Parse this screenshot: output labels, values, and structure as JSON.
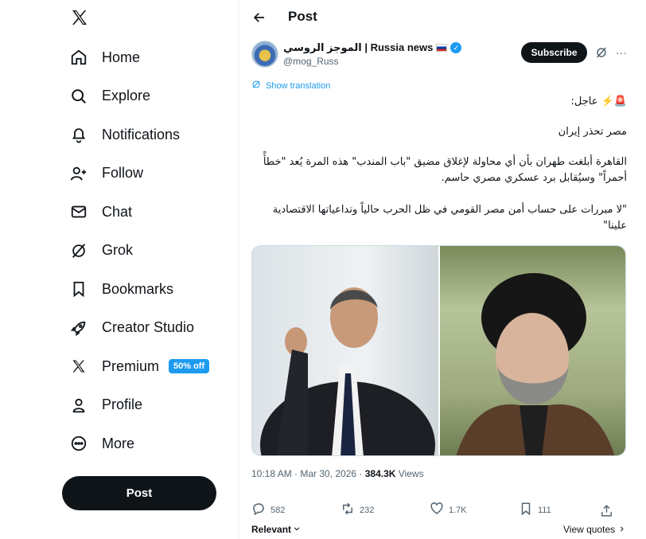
{
  "sidebar": {
    "logo": "x-logo-icon",
    "items": [
      {
        "label": "Home",
        "icon": "home-icon"
      },
      {
        "label": "Explore",
        "icon": "search-icon"
      },
      {
        "label": "Notifications",
        "icon": "bell-icon"
      },
      {
        "label": "Follow",
        "icon": "add-person-icon"
      },
      {
        "label": "Chat",
        "icon": "mail-icon"
      },
      {
        "label": "Grok",
        "icon": "grok-icon"
      },
      {
        "label": "Bookmarks",
        "icon": "bookmark-icon"
      },
      {
        "label": "Creator Studio",
        "icon": "rocket-icon"
      },
      {
        "label": "Premium",
        "icon": "x-logo-icon",
        "badge": "50% off"
      },
      {
        "label": "Profile",
        "icon": "person-icon"
      },
      {
        "label": "More",
        "icon": "more-circle-icon"
      }
    ],
    "post_button": "Post"
  },
  "header": {
    "title": "Post"
  },
  "post": {
    "author_name": "الموجز الروسي | Russia news",
    "author_handle": "@mog_Russ",
    "subscribe_label": "Subscribe",
    "translate_label": "Show translation",
    "lines": [
      "🚨⚡️ عاجل:",
      "مصر تحذر إيران",
      "القاهرة أبلغت طهران بأن أي محاولة لإغلاق مضيق \"باب المندب\" هذه المرة يُعد \"خطأً أحمراً\" وسيُقابل برد عسكري مصري حاسم.",
      "\"لا مبررات على حساب أمن مصر القومي في ظل الحرب حالياً وتداعياتها الاقتصادية علينا\""
    ],
    "time": "10:18 AM · Mar 30, 2026 · ",
    "views_count": "384.3K",
    "views_label": " Views",
    "replies": "582",
    "reposts": "232",
    "likes": "1.7K",
    "bookmarks": "111",
    "sort_label": "Relevant",
    "view_quotes_label": "View quotes"
  },
  "colors": {
    "accent": "#1d9bf0",
    "text": "#0f1419",
    "muted": "#536471"
  }
}
